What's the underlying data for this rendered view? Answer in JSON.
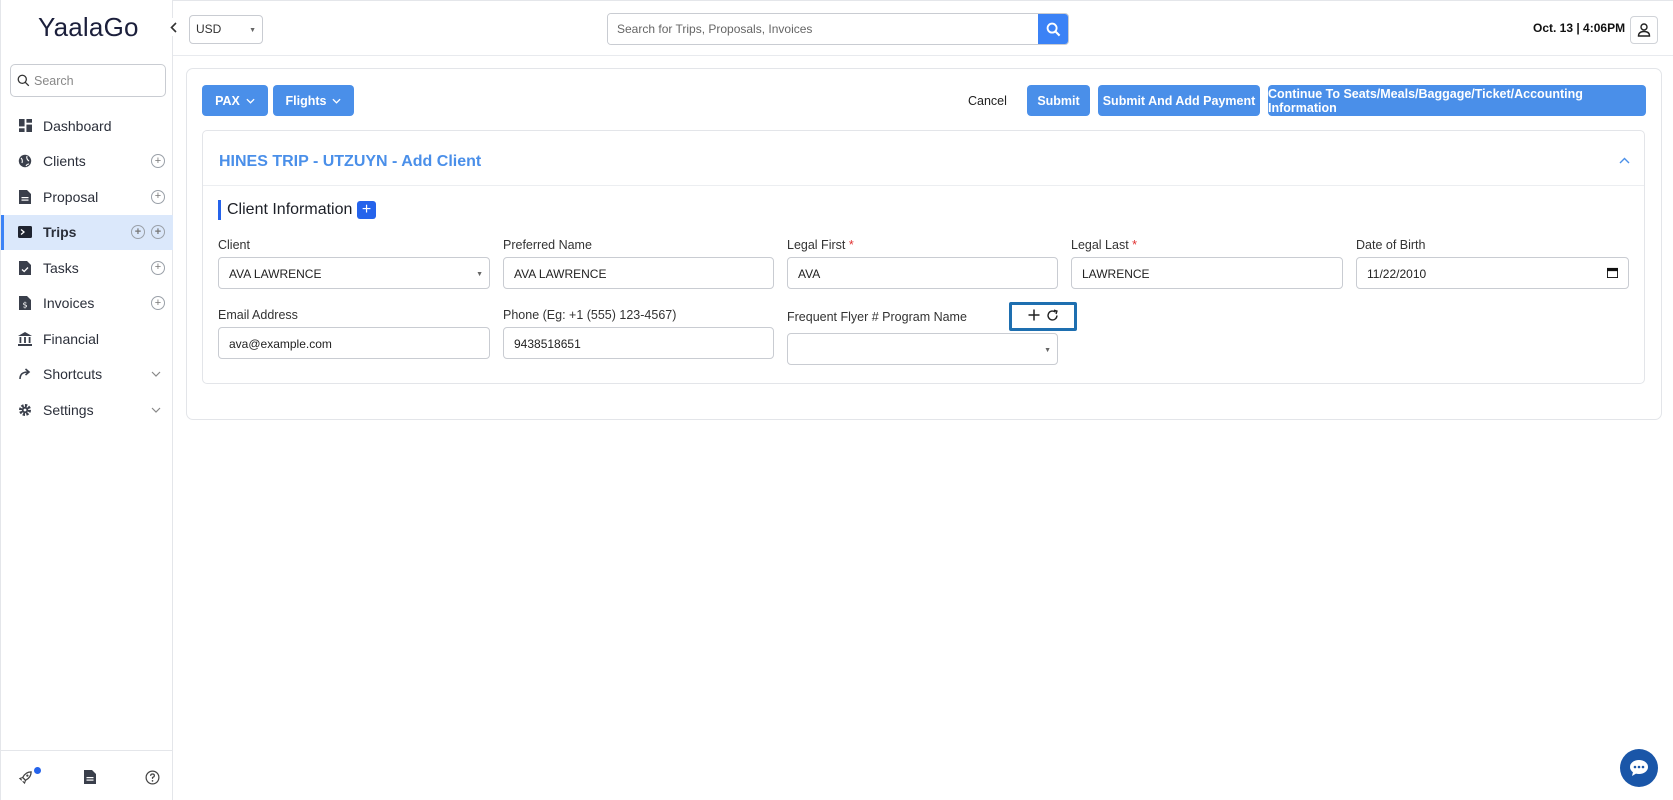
{
  "app": {
    "logo": "YaalaGo"
  },
  "sidebar": {
    "search_placeholder": "Search",
    "items": [
      {
        "label": "Dashboard",
        "icon": "dashboard-icon",
        "add": false
      },
      {
        "label": "Clients",
        "icon": "globe-icon",
        "add": true
      },
      {
        "label": "Proposal",
        "icon": "document-icon",
        "add": true
      },
      {
        "label": "Trips",
        "icon": "terminal-icon",
        "add": true,
        "active": true
      },
      {
        "label": "Tasks",
        "icon": "task-icon",
        "add": true
      },
      {
        "label": "Invoices",
        "icon": "invoice-icon",
        "add": true
      },
      {
        "label": "Financial",
        "icon": "bank-icon",
        "add": false
      },
      {
        "label": "Shortcuts",
        "icon": "share-icon",
        "expand": true
      },
      {
        "label": "Settings",
        "icon": "gear-icon",
        "expand": true
      }
    ]
  },
  "topbar": {
    "currency": "USD",
    "search_placeholder": "Search for Trips, Proposals, Invoices",
    "datetime": "Oct. 13 | 4:06PM"
  },
  "toolbar": {
    "pax": "PAX",
    "flights": "Flights",
    "cancel": "Cancel",
    "submit": "Submit",
    "submit_payment": "Submit And Add Payment",
    "continue": "Continue To Seats/Meals/Baggage/Ticket/Accounting Information"
  },
  "card": {
    "title": "HINES TRIP - UTZUYN - Add Client",
    "section": "Client Information"
  },
  "form": {
    "client_label": "Client",
    "client_value": "AVA LAWRENCE",
    "preferred_label": "Preferred Name",
    "preferred_value": "AVA LAWRENCE",
    "legal_first_label": "Legal First",
    "legal_first_value": "AVA",
    "legal_last_label": "Legal Last",
    "legal_last_value": "LAWRENCE",
    "dob_label": "Date of Birth",
    "dob_value": "11/22/2010",
    "email_label": "Email Address",
    "email_value": "ava@example.com",
    "phone_label": "Phone (Eg: +1 (555) 123-4567)",
    "phone_value": "9438518651",
    "ff_label": "Frequent Flyer # Program Name",
    "ff_value": "",
    "required_mark": "*"
  },
  "colors": {
    "accent": "#4a8fe9",
    "primary": "#2563eb",
    "highlight": "#1e6fb0"
  }
}
